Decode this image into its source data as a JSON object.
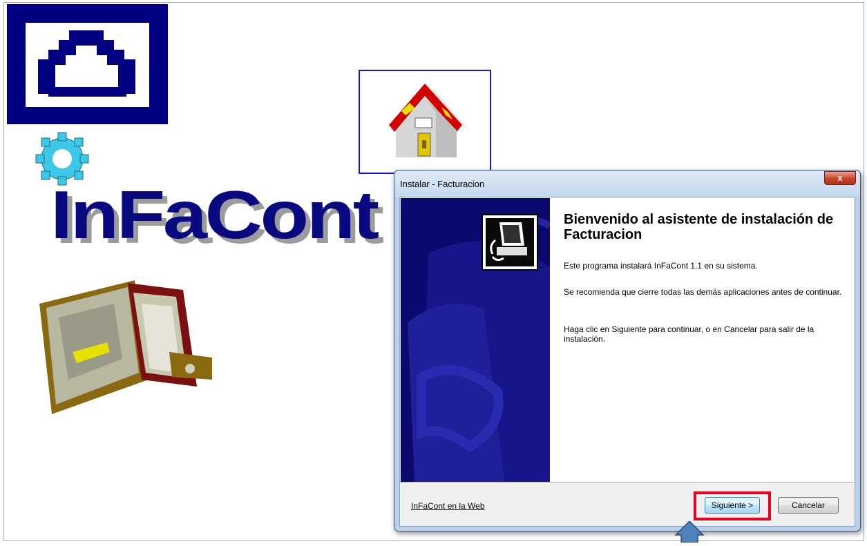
{
  "brand": {
    "text": "InFaCont"
  },
  "dialog": {
    "title": "Instalar - Facturacion",
    "close_label": "x",
    "heading": "Bienvenido al asistente de instalación de Facturacion",
    "paragraphs": [
      "Este programa instalará InFaCont 1.1 en su sistema.",
      "Se recomienda que cierre todas las demás aplicaciones antes de continuar.",
      "Haga clic en Siguiente para continuar, o en Cancelar para salir de la instalación."
    ],
    "web_link": "InFaCont en la Web",
    "next_label": "Siguiente >",
    "cancel_label": "Cancelar"
  },
  "colors": {
    "brand_blue": "#0a0a80",
    "highlight": "#e8001c",
    "banner": "#0a0a6e"
  },
  "icons": [
    "home-logo-icon",
    "home-icon",
    "gear-icon",
    "wallet-icon",
    "install-computer-icon",
    "close-icon",
    "pointer-arrow-icon"
  ]
}
